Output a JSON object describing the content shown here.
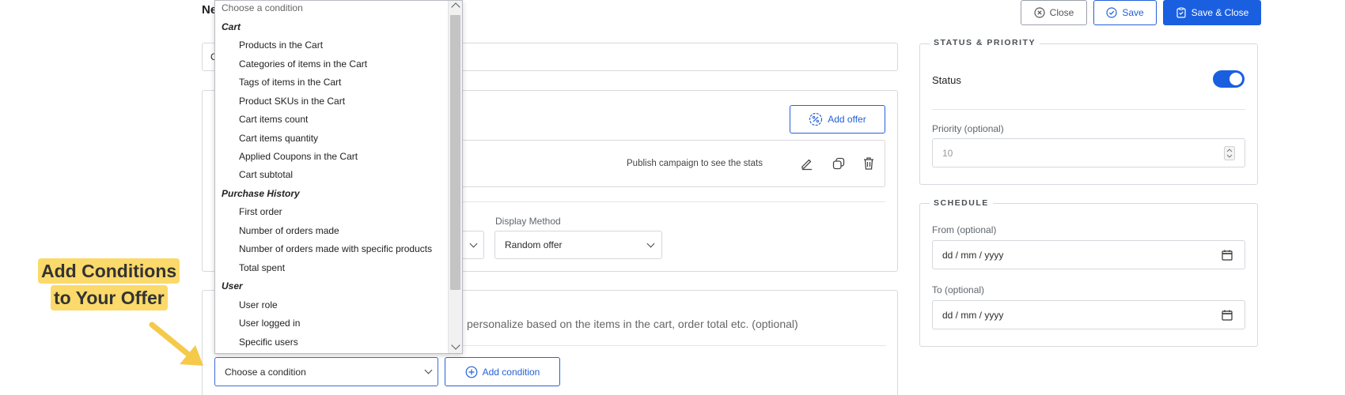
{
  "header": {
    "title_partial": "Ne",
    "close_label": "Close",
    "save_label": "Save",
    "save_close_label": "Save & Close"
  },
  "dropdown": {
    "placeholder": "Choose a condition",
    "groups": [
      {
        "label": "Cart",
        "options": [
          "Products in the Cart",
          "Categories of items in the Cart",
          "Tags of items in the Cart",
          "Product SKUs in the Cart",
          "Cart items count",
          "Cart items quantity",
          "Applied Coupons in the Cart",
          "Cart subtotal"
        ]
      },
      {
        "label": "Purchase History",
        "options": [
          "First order",
          "Number of orders made",
          "Number of orders made with specific products",
          "Total spent"
        ]
      },
      {
        "label": "User",
        "options": [
          "User role",
          "User logged in",
          "Specific users"
        ]
      }
    ]
  },
  "offers": {
    "add_offer_label": "Add offer",
    "stats_text": "Publish campaign to see the stats",
    "display_method_label": "Display Method",
    "display_method_value": "Random offer"
  },
  "conditions": {
    "description": "personalize based on the items in the cart, order total etc. (optional)",
    "select_value": "Choose a condition",
    "add_condition_label": "Add condition"
  },
  "callout": {
    "line1": "Add Conditions",
    "line2": "to Your Offer"
  },
  "status_priority": {
    "legend": "STATUS & PRIORITY",
    "status_label": "Status",
    "status_on": true,
    "priority_label": "Priority (optional)",
    "priority_placeholder": "10"
  },
  "schedule": {
    "legend": "SCHEDULE",
    "from_label": "From (optional)",
    "from_placeholder": "dd / mm / yyyy",
    "to_label": "To (optional)",
    "to_placeholder": "dd / mm / yyyy"
  },
  "colors": {
    "primary": "#1a5fe0",
    "callout": "#fbd96a",
    "arrow": "#f5c94a"
  }
}
